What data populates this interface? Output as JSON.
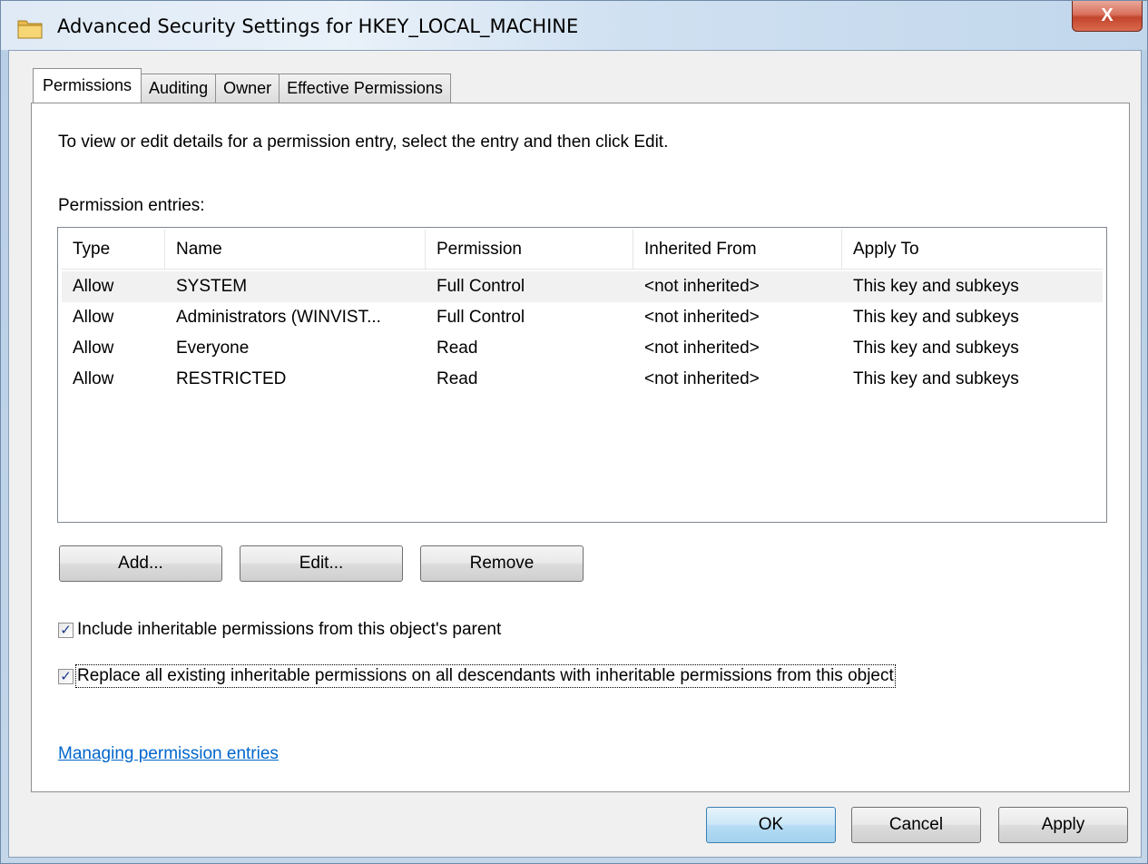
{
  "window": {
    "title": "Advanced Security Settings for HKEY_LOCAL_MACHINE",
    "close_glyph": "X"
  },
  "tabs": [
    {
      "label": "Permissions",
      "active": true
    },
    {
      "label": "Auditing",
      "active": false
    },
    {
      "label": "Owner",
      "active": false
    },
    {
      "label": "Effective Permissions",
      "active": false
    }
  ],
  "permissions": {
    "instructions": "To view or edit details for a permission entry, select the entry and then click Edit.",
    "entries_label": "Permission entries:",
    "columns": [
      "Type",
      "Name",
      "Permission",
      "Inherited From",
      "Apply To"
    ],
    "rows": [
      [
        "Allow",
        "SYSTEM",
        "Full Control",
        "<not inherited>",
        "This key and subkeys"
      ],
      [
        "Allow",
        "Administrators (WINVIST...",
        "Full Control",
        "<not inherited>",
        "This key and subkeys"
      ],
      [
        "Allow",
        "Everyone",
        "Read",
        "<not inherited>",
        "This key and subkeys"
      ],
      [
        "Allow",
        "RESTRICTED",
        "Read",
        "<not inherited>",
        "This key and subkeys"
      ]
    ],
    "add_label": "Add...",
    "edit_label": "Edit...",
    "remove_label": "Remove",
    "include_inheritable": {
      "label": "Include inheritable permissions from this object's parent",
      "checked": true
    },
    "replace_all": {
      "label": "Replace all existing inheritable permissions on all descendants with inheritable permissions from this object",
      "checked": true
    },
    "help_link": "Managing permission entries"
  },
  "footer": {
    "ok_label": "OK",
    "cancel_label": "Cancel",
    "apply_label": "Apply"
  },
  "colors": {
    "link": "#0066cc",
    "ok_button_border": "#3c7fb1",
    "close_button": "#c2452c"
  }
}
